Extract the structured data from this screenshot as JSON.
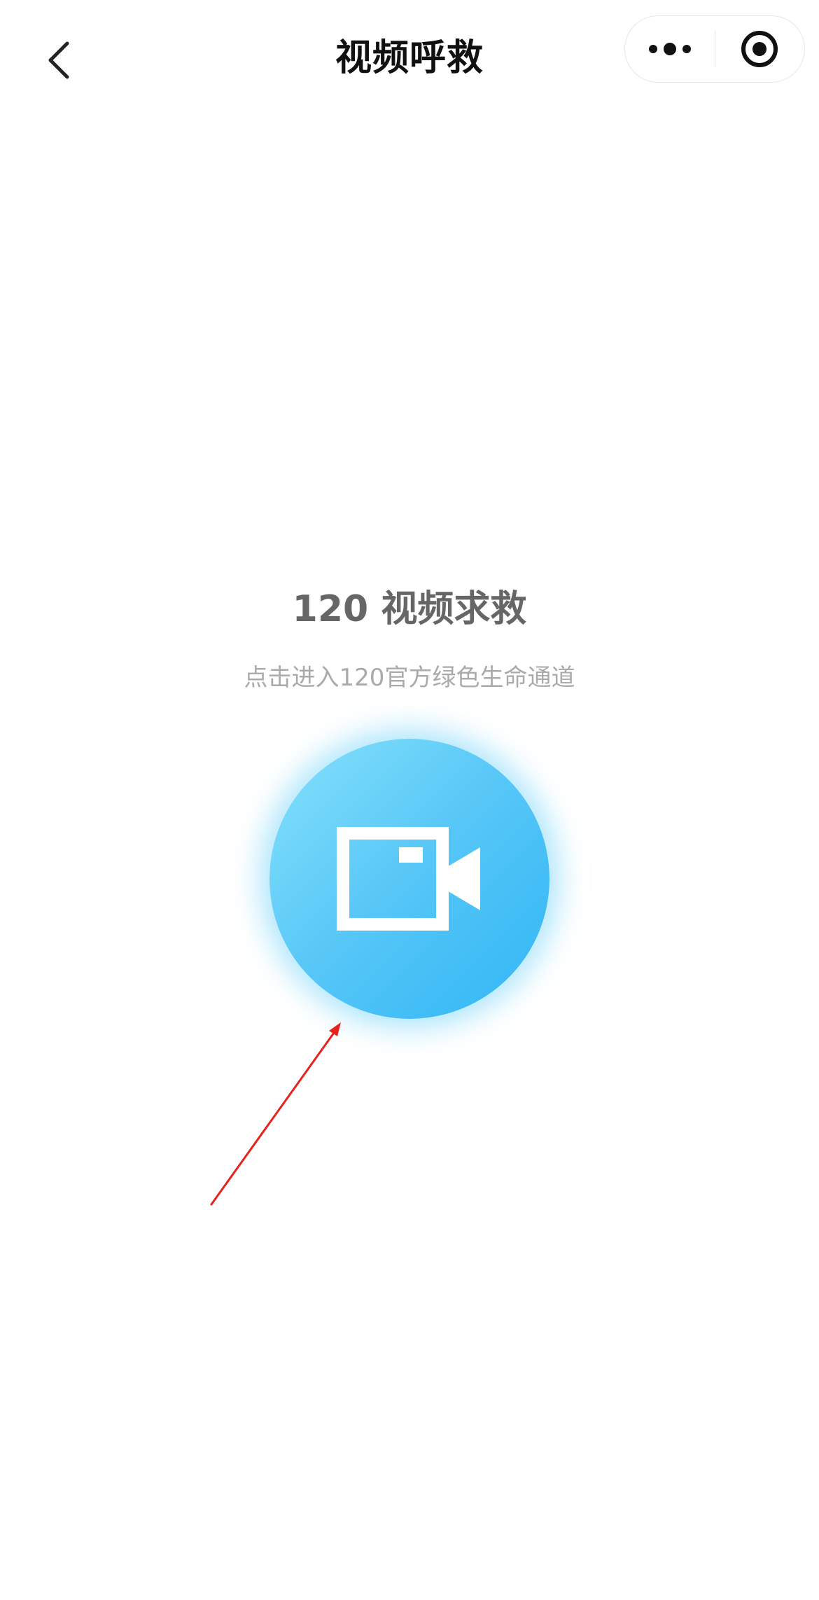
{
  "header": {
    "title": "视频呼救",
    "back_icon": "chevron-left-icon",
    "more_icon": "more-dots-icon",
    "close_icon": "target-circle-icon"
  },
  "main": {
    "headline": "120 视频求救",
    "subtitle": "点击进入120官方绿色生命通道",
    "call_button_icon": "video-camera-icon"
  },
  "colors": {
    "button_gradient_start": "#86e2fb",
    "button_gradient_end": "#30b6f5",
    "annotation_arrow": "#e8231d",
    "headline": "#666666",
    "subtitle": "#aaaaaa"
  }
}
